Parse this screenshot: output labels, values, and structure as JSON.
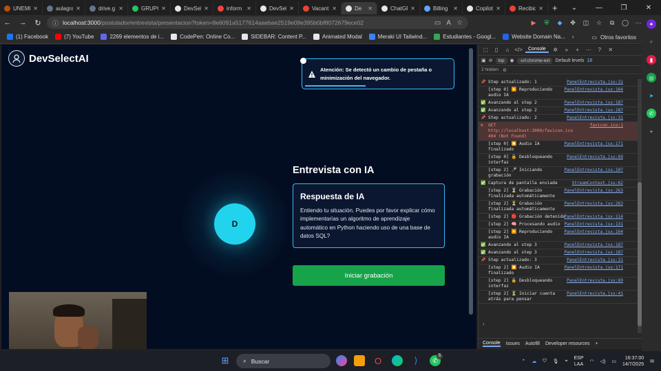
{
  "browser": {
    "tabs": [
      {
        "label": "UNEMI",
        "color": "#b45309"
      },
      {
        "label": "aulagra",
        "color": "#64748b"
      },
      {
        "label": "drive.g",
        "color": "#64748b"
      },
      {
        "label": "GRUPO",
        "color": "#22c55e"
      },
      {
        "label": "DevSel",
        "color": "#e5e7eb"
      },
      {
        "label": "inform",
        "color": "#ef4444"
      },
      {
        "label": "DevSel",
        "color": "#e5e7eb"
      },
      {
        "label": "Vacant",
        "color": "#ea4335"
      },
      {
        "label": "De",
        "color": "#e5e7eb",
        "active": true
      },
      {
        "label": "ChatGP",
        "color": "#e5e7eb"
      },
      {
        "label": "Billing",
        "color": "#60a5fa"
      },
      {
        "label": "Copilot",
        "color": "#e5e7eb"
      },
      {
        "label": "Recibid",
        "color": "#ea4335"
      }
    ],
    "new_tab": "+",
    "window_controls": [
      "⌄",
      "—",
      "❐",
      "✕"
    ],
    "url_host": "localhost:3000",
    "url_path": "/postulador/entrevista/presentacion?token=8e6091a5177614aaebae2519e09e395b0bf8072679ece02",
    "bookmarks": [
      {
        "label": "(1) Facebook",
        "color": "#1877f2"
      },
      {
        "label": "(7) YouTube",
        "color": "#ff0000"
      },
      {
        "label": "2269 elementos de i...",
        "color": "#6366f1"
      },
      {
        "label": "CodePen: Online Co...",
        "color": "#e5e7eb"
      },
      {
        "label": "SIDEBAR: Content P...",
        "color": "#e5e7eb"
      },
      {
        "label": "Animated Modal",
        "color": "#e5e7eb"
      },
      {
        "label": "Meraki UI Tailwind...",
        "color": "#3b82f6"
      },
      {
        "label": "Estudiantes - Googl...",
        "color": "#34a853"
      },
      {
        "label": "Website Domain Na...",
        "color": "#2563eb"
      }
    ],
    "other_favorites": "Otros favoritos"
  },
  "app": {
    "brand": "DevSelectAI",
    "alert_text": "Atención: Se detectó un cambio de pestaña o minimización del navegador.",
    "interview_title": "Entrevista con IA",
    "response_heading": "Respuesta de IA",
    "response_body": "Entiendo tu situación. Puedes por favor explicar cómo implementarías un algoritmo de aprendizaje automático en Python haciendo uso de una base de datos SQL?",
    "avatar_letter": "D",
    "record_button": "Iniciar grabación"
  },
  "devtools": {
    "tabs_label": "Console",
    "context": "top",
    "filter": "-url:chrome-ext",
    "levels": "Default levels",
    "issues_count": "18",
    "hidden": "2 hidden",
    "logs": [
      {
        "icon": "📌",
        "msg": "Step actualizado: 1",
        "src": "PanelEntrevista.jsx:31"
      },
      {
        "icon": "",
        "msg": "[step 0] ▶️ Reproduciendo audio IA",
        "src": "PanelEntrevista.jsx:164"
      },
      {
        "icon": "✅",
        "msg": "Avanzando al step 2",
        "src": "PanelEntrevista.jsx:187"
      },
      {
        "icon": "✅",
        "msg": "Avanzando al step 2",
        "src": "PanelEntrevista.jsx:187"
      },
      {
        "icon": "📌",
        "msg": "Step actualizado: 2",
        "src": "PanelEntrevista.jsx:31"
      },
      {
        "icon": "⊗",
        "msg": "GET http://localhost:3000/favicon.ico 404 (Not Found)",
        "src": "favicon.ico:1",
        "error": true
      },
      {
        "icon": "",
        "msg": "[step 0] ⏹️ Audio IA finalizado",
        "src": "PanelEntrevista.jsx:171"
      },
      {
        "icon": "",
        "msg": "[step 0] 🔓 Desbloqueando interfaz",
        "src": "PanelEntrevista.jsx:69"
      },
      {
        "icon": "",
        "msg": "[step 2] 🎤 Iniciando grabación",
        "src": "PanelEntrevista.jsx:107"
      },
      {
        "icon": "✅",
        "msg": "Captura de pantalla enviada",
        "src": "StreamContext.jsx:62"
      },
      {
        "icon": "",
        "msg": "[step 2] ⏳ Grabación finalizada automáticamente",
        "src": "PanelEntrevista.jsx:263"
      },
      {
        "icon": "",
        "msg": "[step 2] ⏳ Grabación finalizada automáticamente",
        "src": "PanelEntrevista.jsx:263"
      },
      {
        "icon": "",
        "msg": "[step 2] 🔴 Grabación detenida",
        "src": "PanelEntrevista.jsx:114"
      },
      {
        "icon": "",
        "msg": "[step 2] 🧠 Procesando audio",
        "src": "PanelEntrevista.jsx:131"
      },
      {
        "icon": "",
        "msg": "[step 2] ▶️ Reproduciendo audio IA",
        "src": "PanelEntrevista.jsx:164"
      },
      {
        "icon": "✅",
        "msg": "Avanzando al step 3",
        "src": "PanelEntrevista.jsx:187"
      },
      {
        "icon": "✅",
        "msg": "Avanzando al step 3",
        "src": "PanelEntrevista.jsx:187"
      },
      {
        "icon": "📌",
        "msg": "Step actualizado: 3",
        "src": "PanelEntrevista.jsx:31"
      },
      {
        "icon": "",
        "msg": "[step 2] ⏹️ Audio IA finalizado",
        "src": "PanelEntrevista.jsx:171"
      },
      {
        "icon": "",
        "msg": "[step 2] 🔓 Desbloqueando interfaz",
        "src": "PanelEntrevista.jsx:69"
      },
      {
        "icon": "",
        "msg": "[step 2] ⏳ Iniciar cuenta atrás para pensar",
        "src": "PanelEntrevista.jsx:41"
      }
    ],
    "prompt": "›",
    "bottom_tabs": [
      "Console",
      "Issues",
      "Autofill",
      "Developer resources"
    ]
  },
  "taskbar": {
    "search": "Buscar",
    "lang_top": "ESP",
    "lang_bottom": "LAA",
    "time": "16:37:00",
    "date": "14/7/2025",
    "whatsapp_badge": "5"
  }
}
